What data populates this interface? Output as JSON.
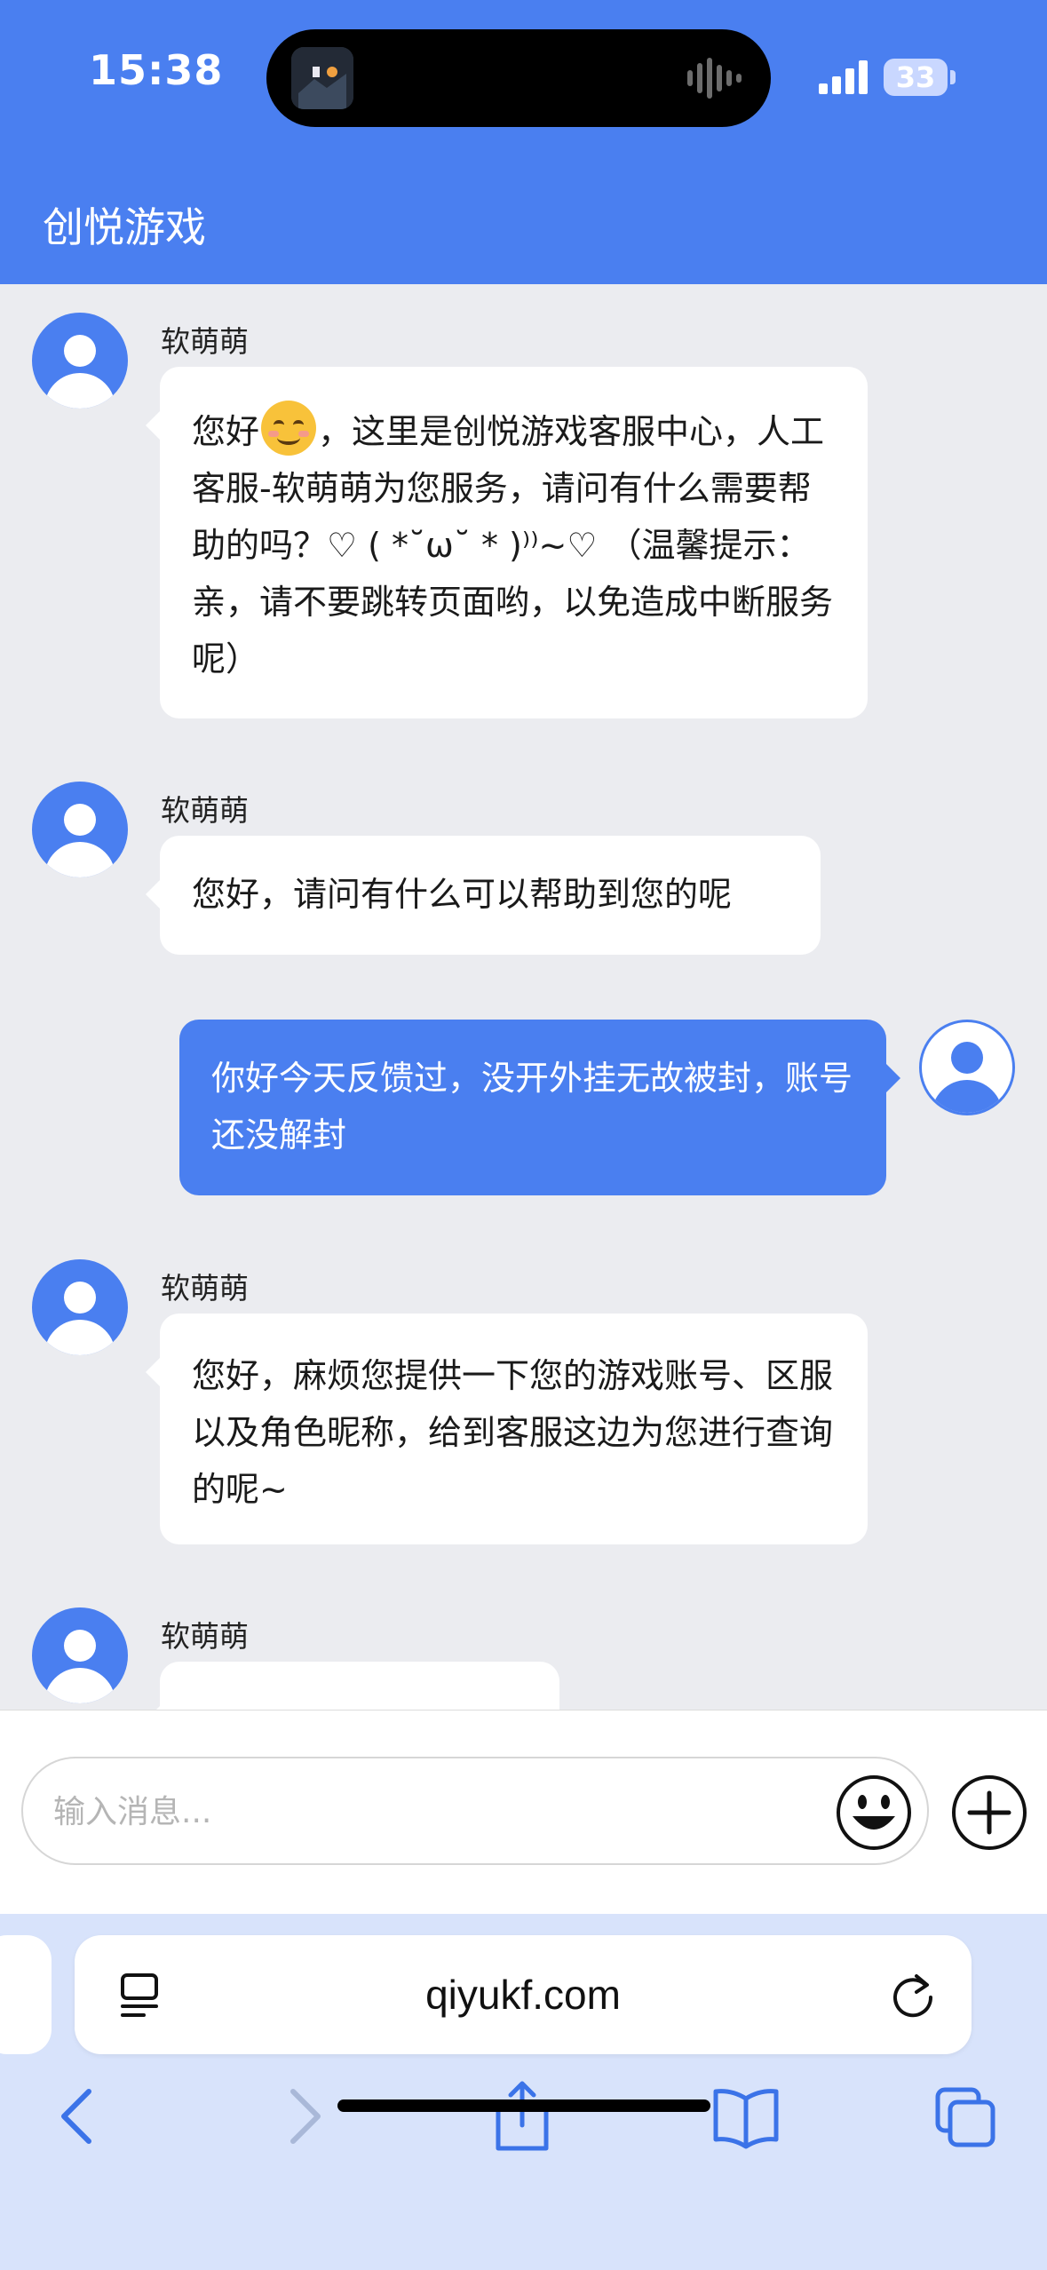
{
  "status_bar": {
    "time": "15:38",
    "battery": "33"
  },
  "header": {
    "title": "创悦游戏"
  },
  "messages": [
    {
      "sender": "软萌萌",
      "text_before_emoji": "您好",
      "emoji": "smiling-face-emoji",
      "text_after_emoji": "，这里是创悦游戏客服中心，人工客服-软萌萌为您服务，请问有什么需要帮助的吗？♡ ( *˘ω˘ * )⁾⁾~♡ （温馨提示：亲，请不要跳转页面哟，以免造成中断服务呢）"
    },
    {
      "sender": "软萌萌",
      "text": "您好，请问有什么可以帮助到您的呢"
    },
    {
      "sender": "me",
      "text": "你好今天反馈过，没开外挂无故被封，账号还没解封"
    },
    {
      "sender": "软萌萌",
      "text": "您好，麻烦您提供一下您的游戏账号、区服以及角色昵称，给到客服这边为您进行查询的呢~"
    },
    {
      "sender": "软萌萌",
      "text": ""
    }
  ],
  "composer": {
    "placeholder": "输入消息..."
  },
  "browser": {
    "url": "qiyukf.com"
  },
  "colors": {
    "accent": "#4a7ff0",
    "chat_background": "#ebecf0",
    "browser_toolbar": "#d8e3fb"
  }
}
